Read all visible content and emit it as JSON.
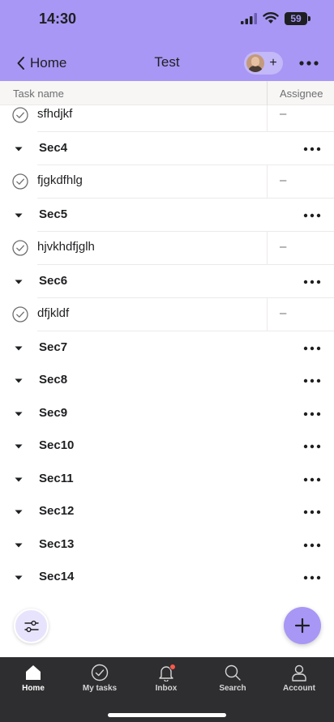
{
  "status_bar": {
    "time": "14:30",
    "battery": "59"
  },
  "nav": {
    "back_label": "Home",
    "title": "Test"
  },
  "columns": {
    "task_name": "Task name",
    "assignee": "Assignee"
  },
  "rows": [
    {
      "kind": "task",
      "name": "sfhdjkf",
      "assignee": "–"
    },
    {
      "kind": "section",
      "name": "Sec4"
    },
    {
      "kind": "task",
      "name": "fjgkdfhlg",
      "assignee": "–"
    },
    {
      "kind": "section",
      "name": "Sec5"
    },
    {
      "kind": "task",
      "name": "hjvkhdfjglh",
      "assignee": "–"
    },
    {
      "kind": "section",
      "name": "Sec6"
    },
    {
      "kind": "task",
      "name": "dfjkldf",
      "assignee": "–"
    },
    {
      "kind": "section",
      "name": "Sec7"
    },
    {
      "kind": "section",
      "name": "Sec8"
    },
    {
      "kind": "section",
      "name": "Sec9"
    },
    {
      "kind": "section",
      "name": "Sec10"
    },
    {
      "kind": "section",
      "name": "Sec11"
    },
    {
      "kind": "section",
      "name": "Sec12"
    },
    {
      "kind": "section",
      "name": "Sec13"
    },
    {
      "kind": "section",
      "name": "Sec14"
    }
  ],
  "tabs": [
    {
      "label": "Home",
      "icon": "home-icon",
      "active": true
    },
    {
      "label": "My tasks",
      "icon": "check-circle-icon",
      "active": false
    },
    {
      "label": "Inbox",
      "icon": "bell-icon",
      "active": false,
      "badge": true
    },
    {
      "label": "Search",
      "icon": "search-icon",
      "active": false
    },
    {
      "label": "Account",
      "icon": "person-icon",
      "active": false
    }
  ],
  "colors": {
    "header": "#a897f5",
    "tabbar": "#2e2e30",
    "accent": "#a897f5",
    "badge": "#ff584a"
  }
}
